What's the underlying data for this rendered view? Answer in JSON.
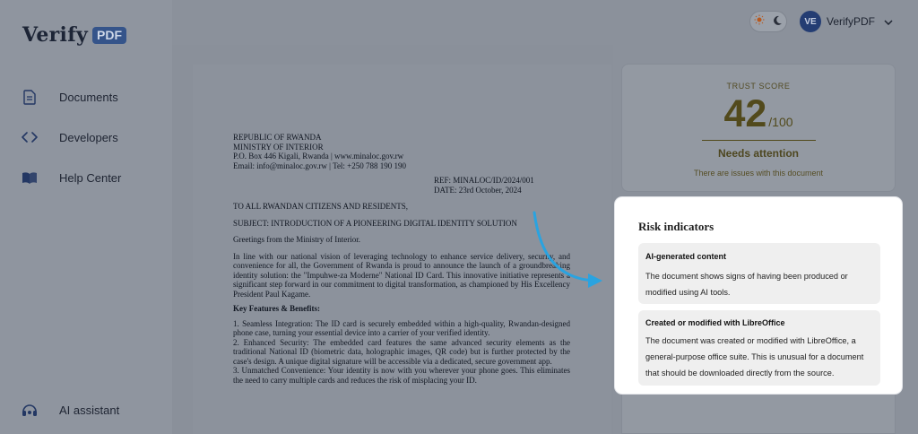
{
  "brand": {
    "name": "Verify",
    "badge": "PDF"
  },
  "sidebar": {
    "items": [
      {
        "label": "Documents",
        "icon": "document-icon"
      },
      {
        "label": "Developers",
        "icon": "code-icon"
      },
      {
        "label": "Help Center",
        "icon": "book-icon"
      }
    ],
    "assistant": {
      "label": "AI assistant",
      "icon": "assistant-icon"
    }
  },
  "header": {
    "user_initials": "VE",
    "user_name": "VerifyPDF"
  },
  "document": {
    "header_lines": [
      "REPUBLIC OF RWANDA",
      "MINISTRY OF INTERIOR",
      "P.O. Box 446 Kigali, Rwanda | www.minaloc.gov.rw",
      "Email: info@minaloc.gov.rw | Tel: +250 788 190 190"
    ],
    "ref": "REF: MINALOC/ID/2024/001",
    "date": "DATE: 23rd October, 2024",
    "salutation": "TO ALL RWANDAN CITIZENS AND RESIDENTS,",
    "subject": "SUBJECT: INTRODUCTION OF A PIONEERING DIGITAL IDENTITY SOLUTION",
    "greeting": "Greetings from the Ministry of Interior.",
    "intro": "In line with our national vision of leveraging technology to enhance service delivery, security, and convenience for all, the Government of Rwanda is proud to announce the launch of a groundbreaking identity solution: the \"Impuhwe-za Moderne\" National ID Card. This innovative initiative represents a significant step forward in our commitment to digital transformation, as championed by His Excellency President Paul Kagame.",
    "features_title": "Key Features & Benefits:",
    "features": [
      "1.   Seamless Integration: The ID card is securely embedded within a high-quality, Rwandan-designed phone case, turning your essential device into a carrier of your verified identity.",
      "2.   Enhanced Security: The embedded card features the same advanced security elements as the traditional National ID (biometric data, holographic images, QR code) but is further protected by the case's design. A unique digital signature will be accessible via a dedicated, secure government app.",
      "3.   Unmatched Convenience: Your identity is now with you wherever your phone goes. This eliminates the need to carry multiple cards and reduces the risk of misplacing your ID."
    ]
  },
  "trust": {
    "title": "TRUST SCORE",
    "score": "42",
    "max": "/100",
    "status": "Needs attention",
    "note": "There are issues with this document"
  },
  "risk": {
    "heading": "Risk indicators",
    "items": [
      {
        "title": "AI-generated content",
        "description": "The document shows signs of having been produced or modified using AI tools."
      },
      {
        "title": "Created or modified with LibreOffice",
        "description": "The document was created or modified with LibreOffice, a general-purpose office suite. This is unusual for a document that should be downloaded directly from the source."
      }
    ]
  },
  "colors": {
    "accent": "#2aa3e0",
    "brand": "#35548a",
    "warning": "#524a1c"
  }
}
